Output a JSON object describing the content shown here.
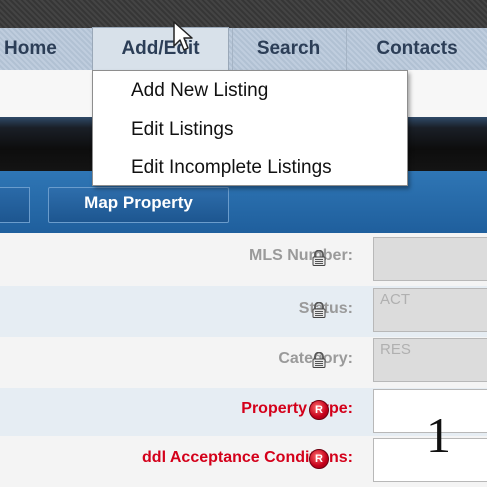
{
  "nav": {
    "home": "Home",
    "add_edit": "Add/Edit",
    "search": "Search",
    "contacts": "Contacts"
  },
  "dropdown": {
    "items": [
      "Add New Listing",
      "Edit Listings",
      "Edit Incomplete Listings"
    ]
  },
  "toolbar": {
    "map_property": "Map Property"
  },
  "form": {
    "rows": [
      {
        "label": "MLS Number:",
        "value": "",
        "icon": "lock-icon"
      },
      {
        "label": "Status:",
        "value": "ACT",
        "icon": "lock-icon"
      },
      {
        "label": "Category:",
        "value": "RES",
        "icon": "lock-icon"
      },
      {
        "label": "Property Type:",
        "value": "",
        "icon": "required-icon"
      },
      {
        "label": "ddl Acceptance Conditions:",
        "value": "",
        "icon": "required-icon"
      }
    ],
    "required_badge": "R"
  },
  "overlay_number": "1",
  "colors": {
    "nav_bg": "#b9c8d8",
    "toolbar_blue": "#2f76b5",
    "required_red": "#d4001a",
    "readonly_label": "#9a9a9a"
  }
}
